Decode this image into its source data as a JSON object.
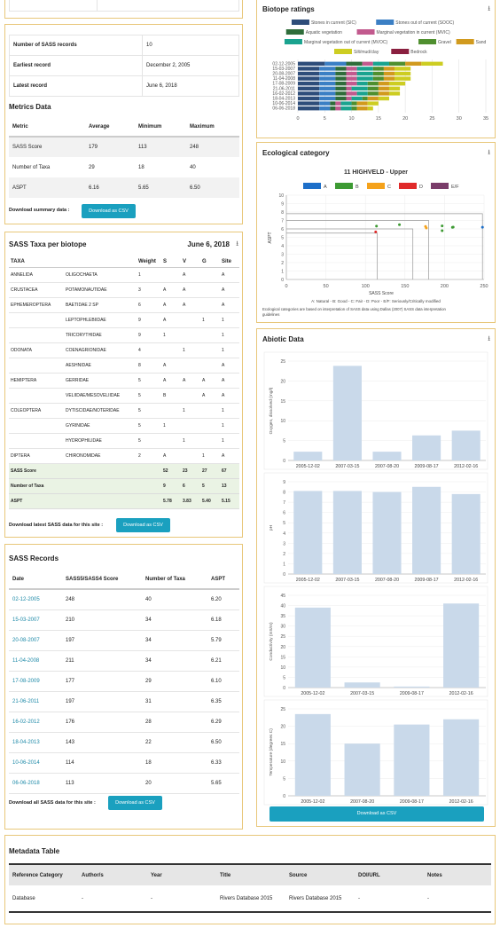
{
  "top_stub": {
    "cells": [
      "",
      ""
    ]
  },
  "summary": {
    "rows": [
      {
        "label": "Number of SASS records",
        "value": "10"
      },
      {
        "label": "Earliest record",
        "value": "December 2, 2005"
      },
      {
        "label": "Latest record",
        "value": "June 6, 2018"
      }
    ]
  },
  "metrics": {
    "title": "Metrics Data",
    "headers": [
      "Metric",
      "Average",
      "Minimum",
      "Maximum"
    ],
    "rows": [
      [
        "SASS Score",
        "179",
        "113",
        "248"
      ],
      [
        "Number of Taxa",
        "29",
        "18",
        "40"
      ],
      [
        "ASPT",
        "6.16",
        "5.65",
        "6.50"
      ]
    ],
    "download_label": "Download summary data :",
    "button": "Download as CSV"
  },
  "taxa": {
    "title": "SASS Taxa per biotope",
    "date": "June 6, 2018",
    "headers": [
      "TAXA",
      "",
      "Weight",
      "S",
      "V",
      "G",
      "Site"
    ],
    "rows": [
      [
        "ANNELIDA",
        "OLIGOCHAETA",
        "1",
        "",
        "A",
        "",
        "A"
      ],
      [
        "CRUSTACEA",
        "POTAMONAUTIDAE",
        "3",
        "A",
        "A",
        "",
        "A"
      ],
      [
        "EPHEMEROPTERA",
        "BAETIDAE 2 SP",
        "6",
        "A",
        "A",
        "",
        "A"
      ],
      [
        "",
        "LEPTOPHLEBIIDAE",
        "9",
        "A",
        "",
        "1",
        "1"
      ],
      [
        "",
        "TRICORYTHIDAE",
        "9",
        "1",
        "",
        "",
        "1"
      ],
      [
        "ODONATA",
        "COENAGRIONIDAE",
        "4",
        "",
        "1",
        "",
        "1"
      ],
      [
        "",
        "AESHNIDAE",
        "8",
        "A",
        "",
        "",
        "A"
      ],
      [
        "HEMIPTERA",
        "GERRIDAE",
        "5",
        "A",
        "A",
        "A",
        "A"
      ],
      [
        "",
        "VELIIDAE/MESOVELIIDAE",
        "5",
        "B",
        "",
        "A",
        "A"
      ],
      [
        "COLEOPTERA",
        "DYTISCIDAE/NOTERIDAE",
        "5",
        "",
        "1",
        "",
        "1"
      ],
      [
        "",
        "GYRINIDAE",
        "5",
        "1",
        "",
        "",
        "1"
      ],
      [
        "",
        "HYDROPHILIDAE",
        "5",
        "",
        "1",
        "",
        "1"
      ],
      [
        "DIPTERA",
        "CHIRONOMIDAE",
        "2",
        "A",
        "",
        "1",
        "A"
      ]
    ],
    "totals": [
      [
        "SASS Score",
        "",
        "",
        "52",
        "23",
        "27",
        "67"
      ],
      [
        "Number of Taxa",
        "",
        "",
        "9",
        "6",
        "5",
        "13"
      ],
      [
        "ASPT",
        "",
        "",
        "5.78",
        "3.83",
        "5.40",
        "5.15"
      ]
    ],
    "download_label": "Download latest SASS data for this site :",
    "button": "Download as CSV"
  },
  "records": {
    "title": "SASS Records",
    "headers": [
      "Date",
      "SASS5/SASS4 Score",
      "Number of Taxa",
      "ASPT"
    ],
    "rows": [
      [
        "02-12-2005",
        "248",
        "40",
        "6.20"
      ],
      [
        "15-03-2007",
        "210",
        "34",
        "6.18"
      ],
      [
        "20-08-2007",
        "197",
        "34",
        "5.79"
      ],
      [
        "11-04-2008",
        "211",
        "34",
        "6.21"
      ],
      [
        "17-08-2009",
        "177",
        "29",
        "6.10"
      ],
      [
        "21-06-2011",
        "197",
        "31",
        "6.35"
      ],
      [
        "16-02-2012",
        "176",
        "28",
        "6.29"
      ],
      [
        "18-04-2013",
        "143",
        "22",
        "6.50"
      ],
      [
        "10-06-2014",
        "114",
        "18",
        "6.33"
      ],
      [
        "06-06-2018",
        "113",
        "20",
        "5.65"
      ]
    ],
    "download_label": "Download all SASS data for this site :",
    "button": "Download as CSV"
  },
  "metadata": {
    "title": "Metadata Table",
    "headers": [
      "Reference Category",
      "Author/s",
      "Year",
      "Title",
      "Source",
      "DOI/URL",
      "Notes"
    ],
    "rows": [
      [
        "Database",
        "-",
        "-",
        "Rivers Database 2015",
        "Rivers Database 2015",
        "-",
        "-"
      ]
    ]
  },
  "colors": {
    "accent": "#1aa0bf",
    "panel_border": "#e8c77a",
    "bar_fill": "#c9d9ea"
  },
  "icons": {
    "download": "download-icon"
  },
  "chart_data": [
    {
      "type": "bar",
      "title": "Biotope ratings",
      "orientation": "horizontal",
      "stacked": true,
      "categories": [
        "02-12-2005",
        "15-03-2007",
        "20-08-2007",
        "11-04-2008",
        "17-08-2009",
        "21-06-2011",
        "16-02-2012",
        "18-04-2013",
        "10-06-2014",
        "06-06-2018"
      ],
      "series": [
        {
          "name": "Stones in current (SIC)",
          "color": "#2e4d7a",
          "values": [
            5,
            4,
            4,
            4,
            4,
            4,
            4,
            4,
            4,
            4
          ]
        },
        {
          "name": "Stones out of current (SOOC)",
          "color": "#3b7fc4",
          "values": [
            4,
            3,
            3,
            3,
            3,
            3,
            3,
            3,
            2,
            2
          ]
        },
        {
          "name": "Aquatic vegetation",
          "color": "#2f6d3a",
          "values": [
            3,
            2,
            2,
            2,
            2,
            2,
            2,
            2,
            1,
            1
          ]
        },
        {
          "name": "Marginal vegetation in current (MVIC)",
          "color": "#c25a8e",
          "values": [
            2,
            2,
            2,
            2,
            2,
            1,
            2,
            1,
            1,
            1
          ]
        },
        {
          "name": "Marginal vegetation out of current (MVOC)",
          "color": "#1aa38f",
          "values": [
            3,
            3,
            3,
            3,
            2,
            3,
            2,
            2,
            2,
            2
          ]
        },
        {
          "name": "Gravel",
          "color": "#4f8f2f",
          "values": [
            3,
            2,
            2,
            2,
            2,
            2,
            2,
            1,
            1,
            1
          ]
        },
        {
          "name": "Sand",
          "color": "#d19a1e",
          "values": [
            3,
            2,
            2,
            2,
            2,
            2,
            2,
            2,
            2,
            2
          ]
        },
        {
          "name": "Silt/mud/clay",
          "color": "#cdcd22",
          "values": [
            4,
            3,
            3,
            3,
            3,
            2,
            2,
            2,
            2,
            1
          ]
        },
        {
          "name": "Bedrock",
          "color": "#8a1f3f",
          "values": [
            0,
            0,
            0,
            0,
            0,
            0,
            0,
            0,
            0,
            0
          ]
        }
      ],
      "xlim": [
        0,
        35
      ],
      "xticks": [
        "0",
        "5",
        "10",
        "15",
        "20",
        "25",
        "30",
        "35"
      ],
      "legend": "top"
    },
    {
      "type": "scatter",
      "title": "11 HIGHVELD - Upper",
      "xlabel": "SASS Score",
      "ylabel": "ASPT",
      "xlim": [
        0,
        250
      ],
      "ylim": [
        0,
        10
      ],
      "xticks": [
        "0",
        "50",
        "100",
        "150",
        "200",
        "250"
      ],
      "yticks": [
        "0",
        "1",
        "2",
        "3",
        "4",
        "5",
        "6",
        "7",
        "8",
        "9",
        "10"
      ],
      "legend_items": [
        {
          "name": "A",
          "color": "#1d6fc9"
        },
        {
          "name": "B",
          "color": "#3d9a33"
        },
        {
          "name": "C",
          "color": "#f5a21b"
        },
        {
          "name": "D",
          "color": "#e02a2a"
        },
        {
          "name": "E/F",
          "color": "#7a3d6a"
        }
      ],
      "points": [
        {
          "x": 248,
          "y": 6.2,
          "color": "#1d6fc9"
        },
        {
          "x": 210,
          "y": 6.18,
          "color": "#3d9a33"
        },
        {
          "x": 197,
          "y": 5.79,
          "color": "#3d9a33"
        },
        {
          "x": 211,
          "y": 6.21,
          "color": "#3d9a33"
        },
        {
          "x": 177,
          "y": 6.1,
          "color": "#f5a21b"
        },
        {
          "x": 197,
          "y": 6.35,
          "color": "#3d9a33"
        },
        {
          "x": 176,
          "y": 6.29,
          "color": "#f5a21b"
        },
        {
          "x": 143,
          "y": 6.5,
          "color": "#3d9a33"
        },
        {
          "x": 114,
          "y": 6.33,
          "color": "#3d9a33"
        },
        {
          "x": 113,
          "y": 5.65,
          "color": "#e02a2a"
        }
      ],
      "boundaries": [
        {
          "x": 180,
          "y": 7.0
        },
        {
          "x": 160,
          "y": 6.0
        },
        {
          "x": 115,
          "y": 5.5
        }
      ],
      "notes": [
        "A: Natural - B: Good - C: Fair - D: Poor - E/F: Seriously/Critically modified",
        "Ecological categories are based on interpretation of SASS data using Dallas (2007) SASS data interpretation guidelines"
      ]
    },
    {
      "type": "bar",
      "ylabel": "Oxygen, dissolved (mg/l)",
      "categories": [
        "2005-12-02",
        "2007-03-15",
        "2007-08-20",
        "2009-08-17",
        "2012-02-16"
      ],
      "values": [
        2.2,
        23.8,
        2.2,
        6.3,
        7.5
      ],
      "ylim": [
        0,
        25
      ],
      "yticks": [
        0,
        5,
        10,
        15,
        20,
        25
      ]
    },
    {
      "type": "bar",
      "ylabel": "pH",
      "categories": [
        "2005-12-02",
        "2007-03-15",
        "2007-08-20",
        "2009-08-17",
        "2012-02-16"
      ],
      "values": [
        8.1,
        8.1,
        8.0,
        8.5,
        7.8
      ],
      "ylim": [
        0,
        9
      ],
      "yticks": [
        0,
        1,
        2,
        3,
        4,
        5,
        6,
        7,
        8,
        9
      ]
    },
    {
      "type": "bar",
      "ylabel": "Conductivity (mS/m)",
      "categories": [
        "2005-12-02",
        "2007-03-15",
        "2009-08-17",
        "2012-02-16"
      ],
      "values": [
        39,
        2.5,
        0.5,
        41
      ],
      "ylim": [
        0,
        45
      ],
      "yticks": [
        0,
        5,
        10,
        15,
        20,
        25,
        30,
        35,
        40,
        45
      ]
    },
    {
      "type": "bar",
      "ylabel": "Temperature (degrees C)",
      "categories": [
        "2005-12-02",
        "2007-08-20",
        "2009-08-17",
        "2012-02-16"
      ],
      "values": [
        23.5,
        15,
        20.5,
        22
      ],
      "ylim": [
        0,
        25
      ],
      "yticks": [
        0,
        5,
        10,
        15,
        20,
        25
      ]
    }
  ],
  "panels": {
    "biotope_title": "Biotope ratings",
    "eco_title": "Ecological category",
    "abiotic_title": "Abiotic Data",
    "abiotic_button": "Download as CSV"
  }
}
